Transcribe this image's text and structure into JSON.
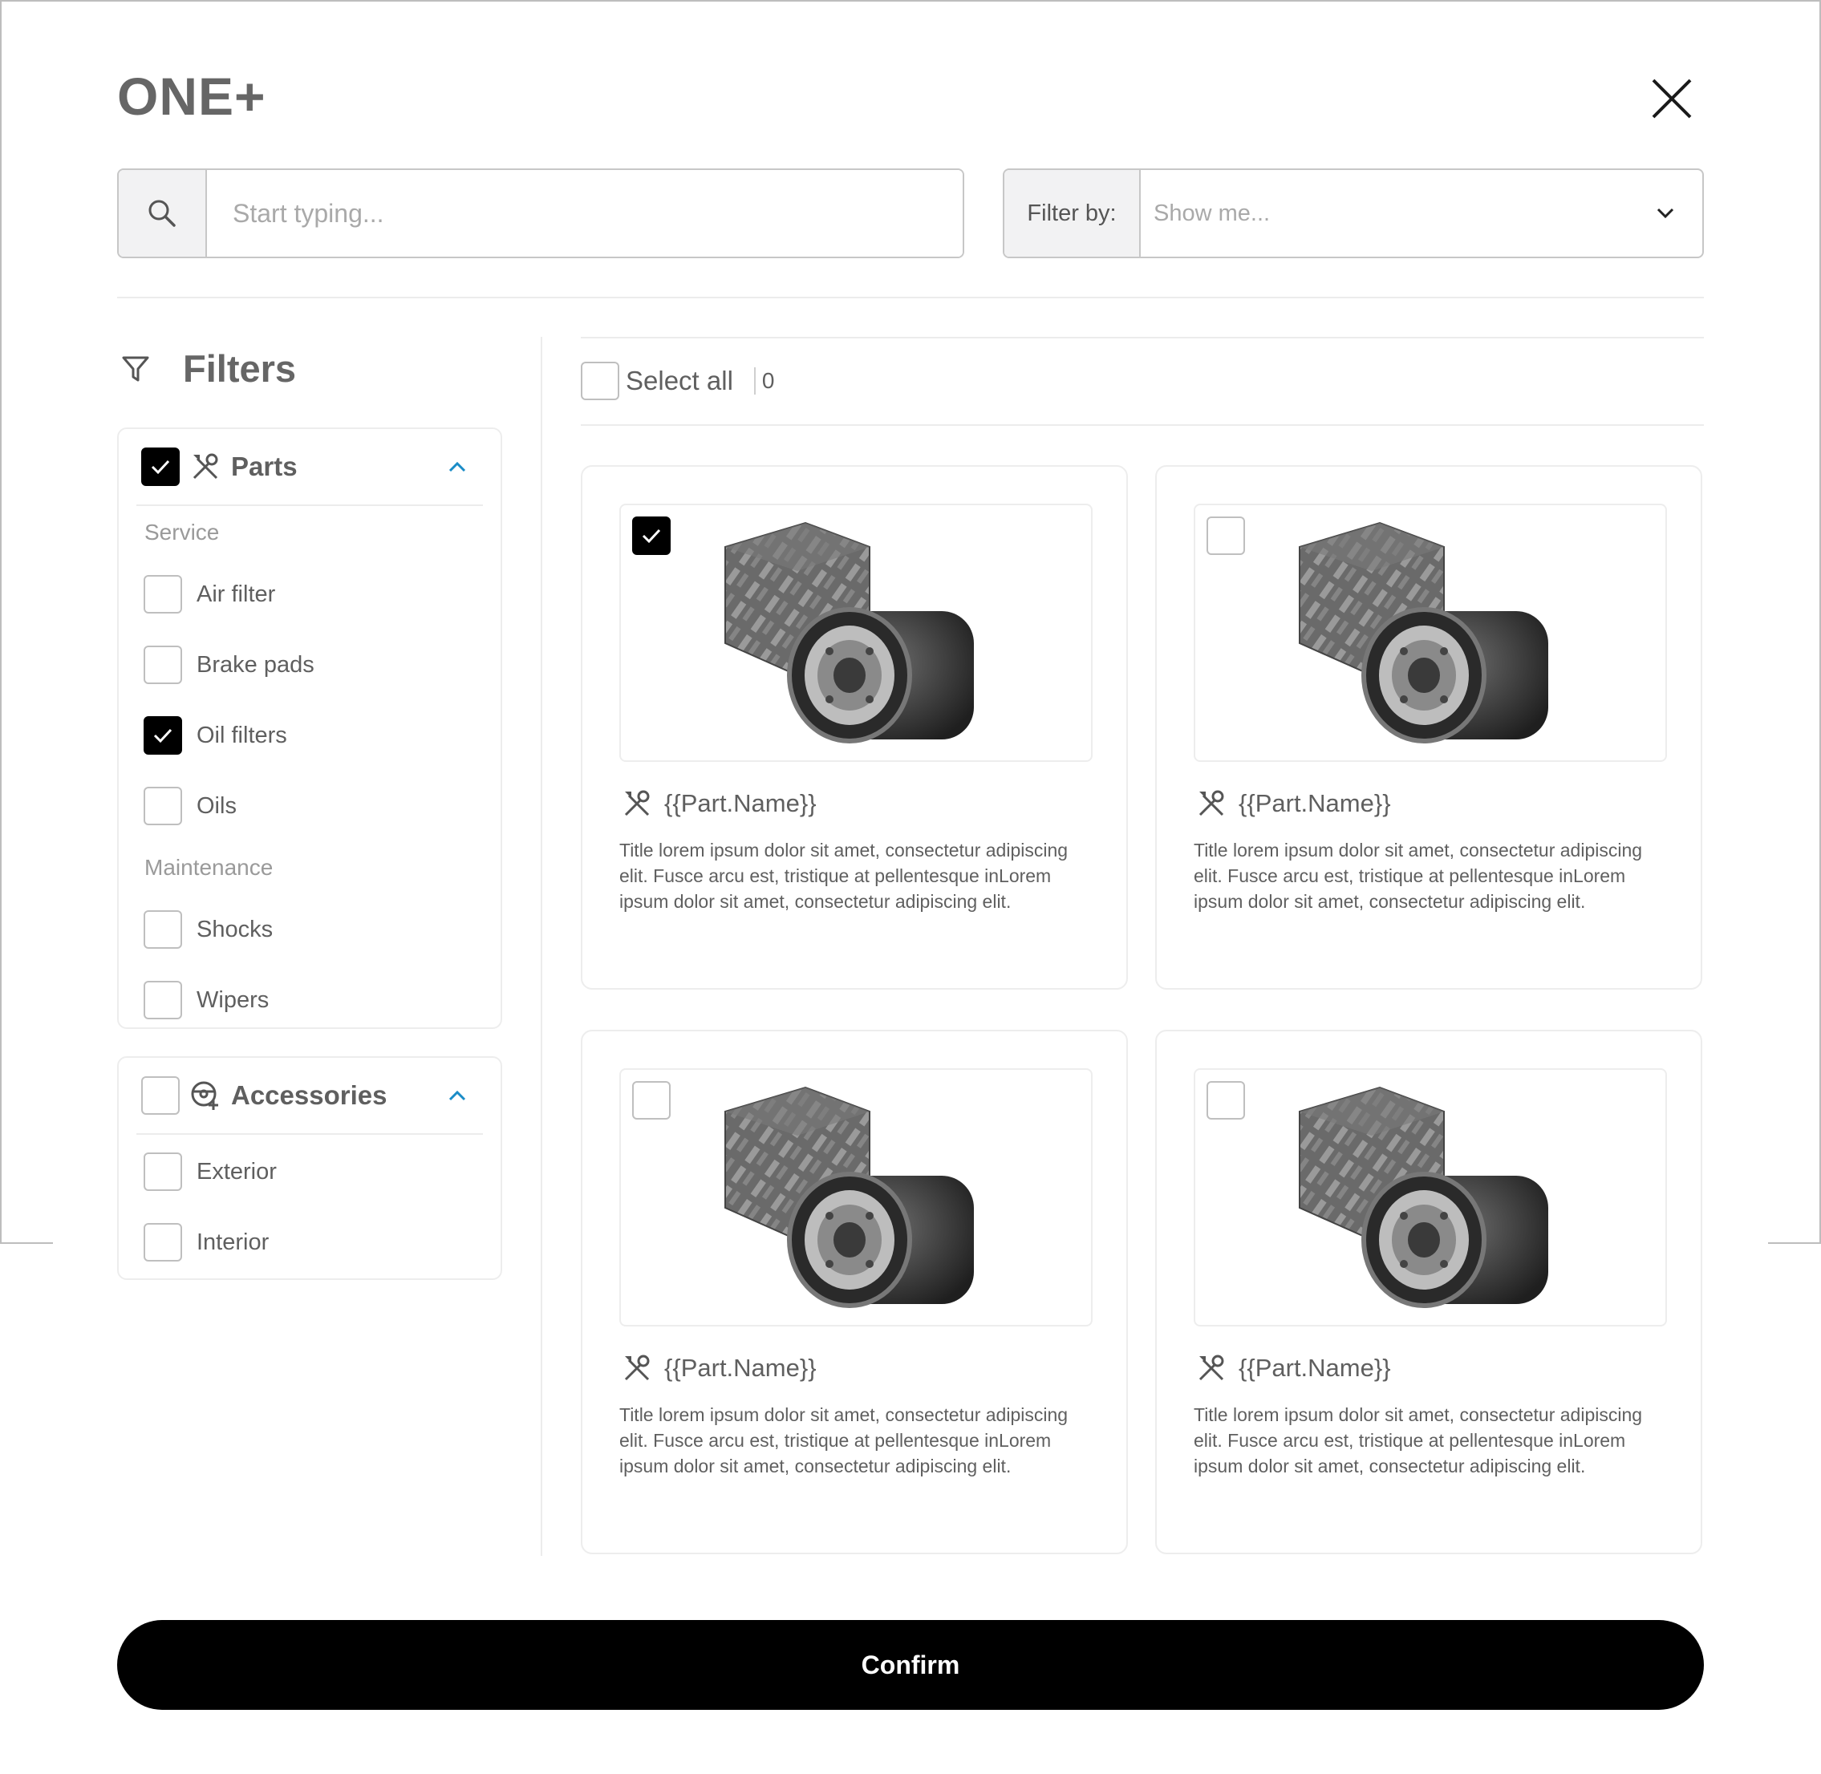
{
  "app": {
    "title": "ONE+"
  },
  "search": {
    "placeholder": "Start typing..."
  },
  "filter_by": {
    "label": "Filter by:",
    "placeholder": "Show me..."
  },
  "filters": {
    "title": "Filters",
    "groups": [
      {
        "title": "Parts",
        "checked": true,
        "expanded": true,
        "sections": [
          {
            "label": "Service",
            "options": [
              {
                "label": "Air filter",
                "checked": false
              },
              {
                "label": "Brake pads",
                "checked": false
              },
              {
                "label": "Oil filters",
                "checked": true
              },
              {
                "label": "Oils",
                "checked": false
              }
            ]
          },
          {
            "label": "Maintenance",
            "options": [
              {
                "label": "Shocks",
                "checked": false
              },
              {
                "label": "Wipers",
                "checked": false
              }
            ]
          }
        ]
      },
      {
        "title": "Accessories",
        "checked": false,
        "expanded": true,
        "options": [
          {
            "label": "Exterior",
            "checked": false
          },
          {
            "label": "Interior",
            "checked": false
          }
        ]
      }
    ]
  },
  "toolbar": {
    "select_all_label": "Select all",
    "selected_count": "0"
  },
  "products": [
    {
      "name": "{{Part.Name}}",
      "checked": true,
      "description": "Title lorem ipsum dolor sit amet, consectetur adipiscing elit. Fusce arcu est, tristique at pellentesque inLorem ipsum dolor sit amet, consectetur adipiscing elit."
    },
    {
      "name": "{{Part.Name}}",
      "checked": false,
      "description": "Title lorem ipsum dolor sit amet, consectetur adipiscing elit. Fusce arcu est, tristique at pellentesque inLorem ipsum dolor sit amet, consectetur adipiscing elit."
    },
    {
      "name": "{{Part.Name}}",
      "checked": false,
      "description": "Title lorem ipsum dolor sit amet, consectetur adipiscing elit. Fusce arcu est, tristique at pellentesque inLorem ipsum dolor sit amet, consectetur adipiscing elit."
    },
    {
      "name": "{{Part.Name}}",
      "checked": false,
      "description": "Title lorem ipsum dolor sit amet, consectetur adipiscing elit. Fusce arcu est, tristique at pellentesque inLorem ipsum dolor sit amet, consectetur adipiscing elit."
    }
  ],
  "confirm": {
    "label": "Confirm"
  },
  "icons": {
    "close": "close-icon",
    "search": "search-icon",
    "dropdown": "chevron-down-icon",
    "filter": "filter-funnel-icon",
    "parts": "tools-icon",
    "accessories": "steering-wheel-plus-icon",
    "collapse": "chevron-up-icon",
    "check": "checkmark-icon"
  },
  "colors": {
    "primary": "#000000",
    "accent_chevron": "#1a8cc7",
    "text": "#5f5f5f",
    "muted": "#9a9a9a",
    "border": "#c7c7c7"
  }
}
